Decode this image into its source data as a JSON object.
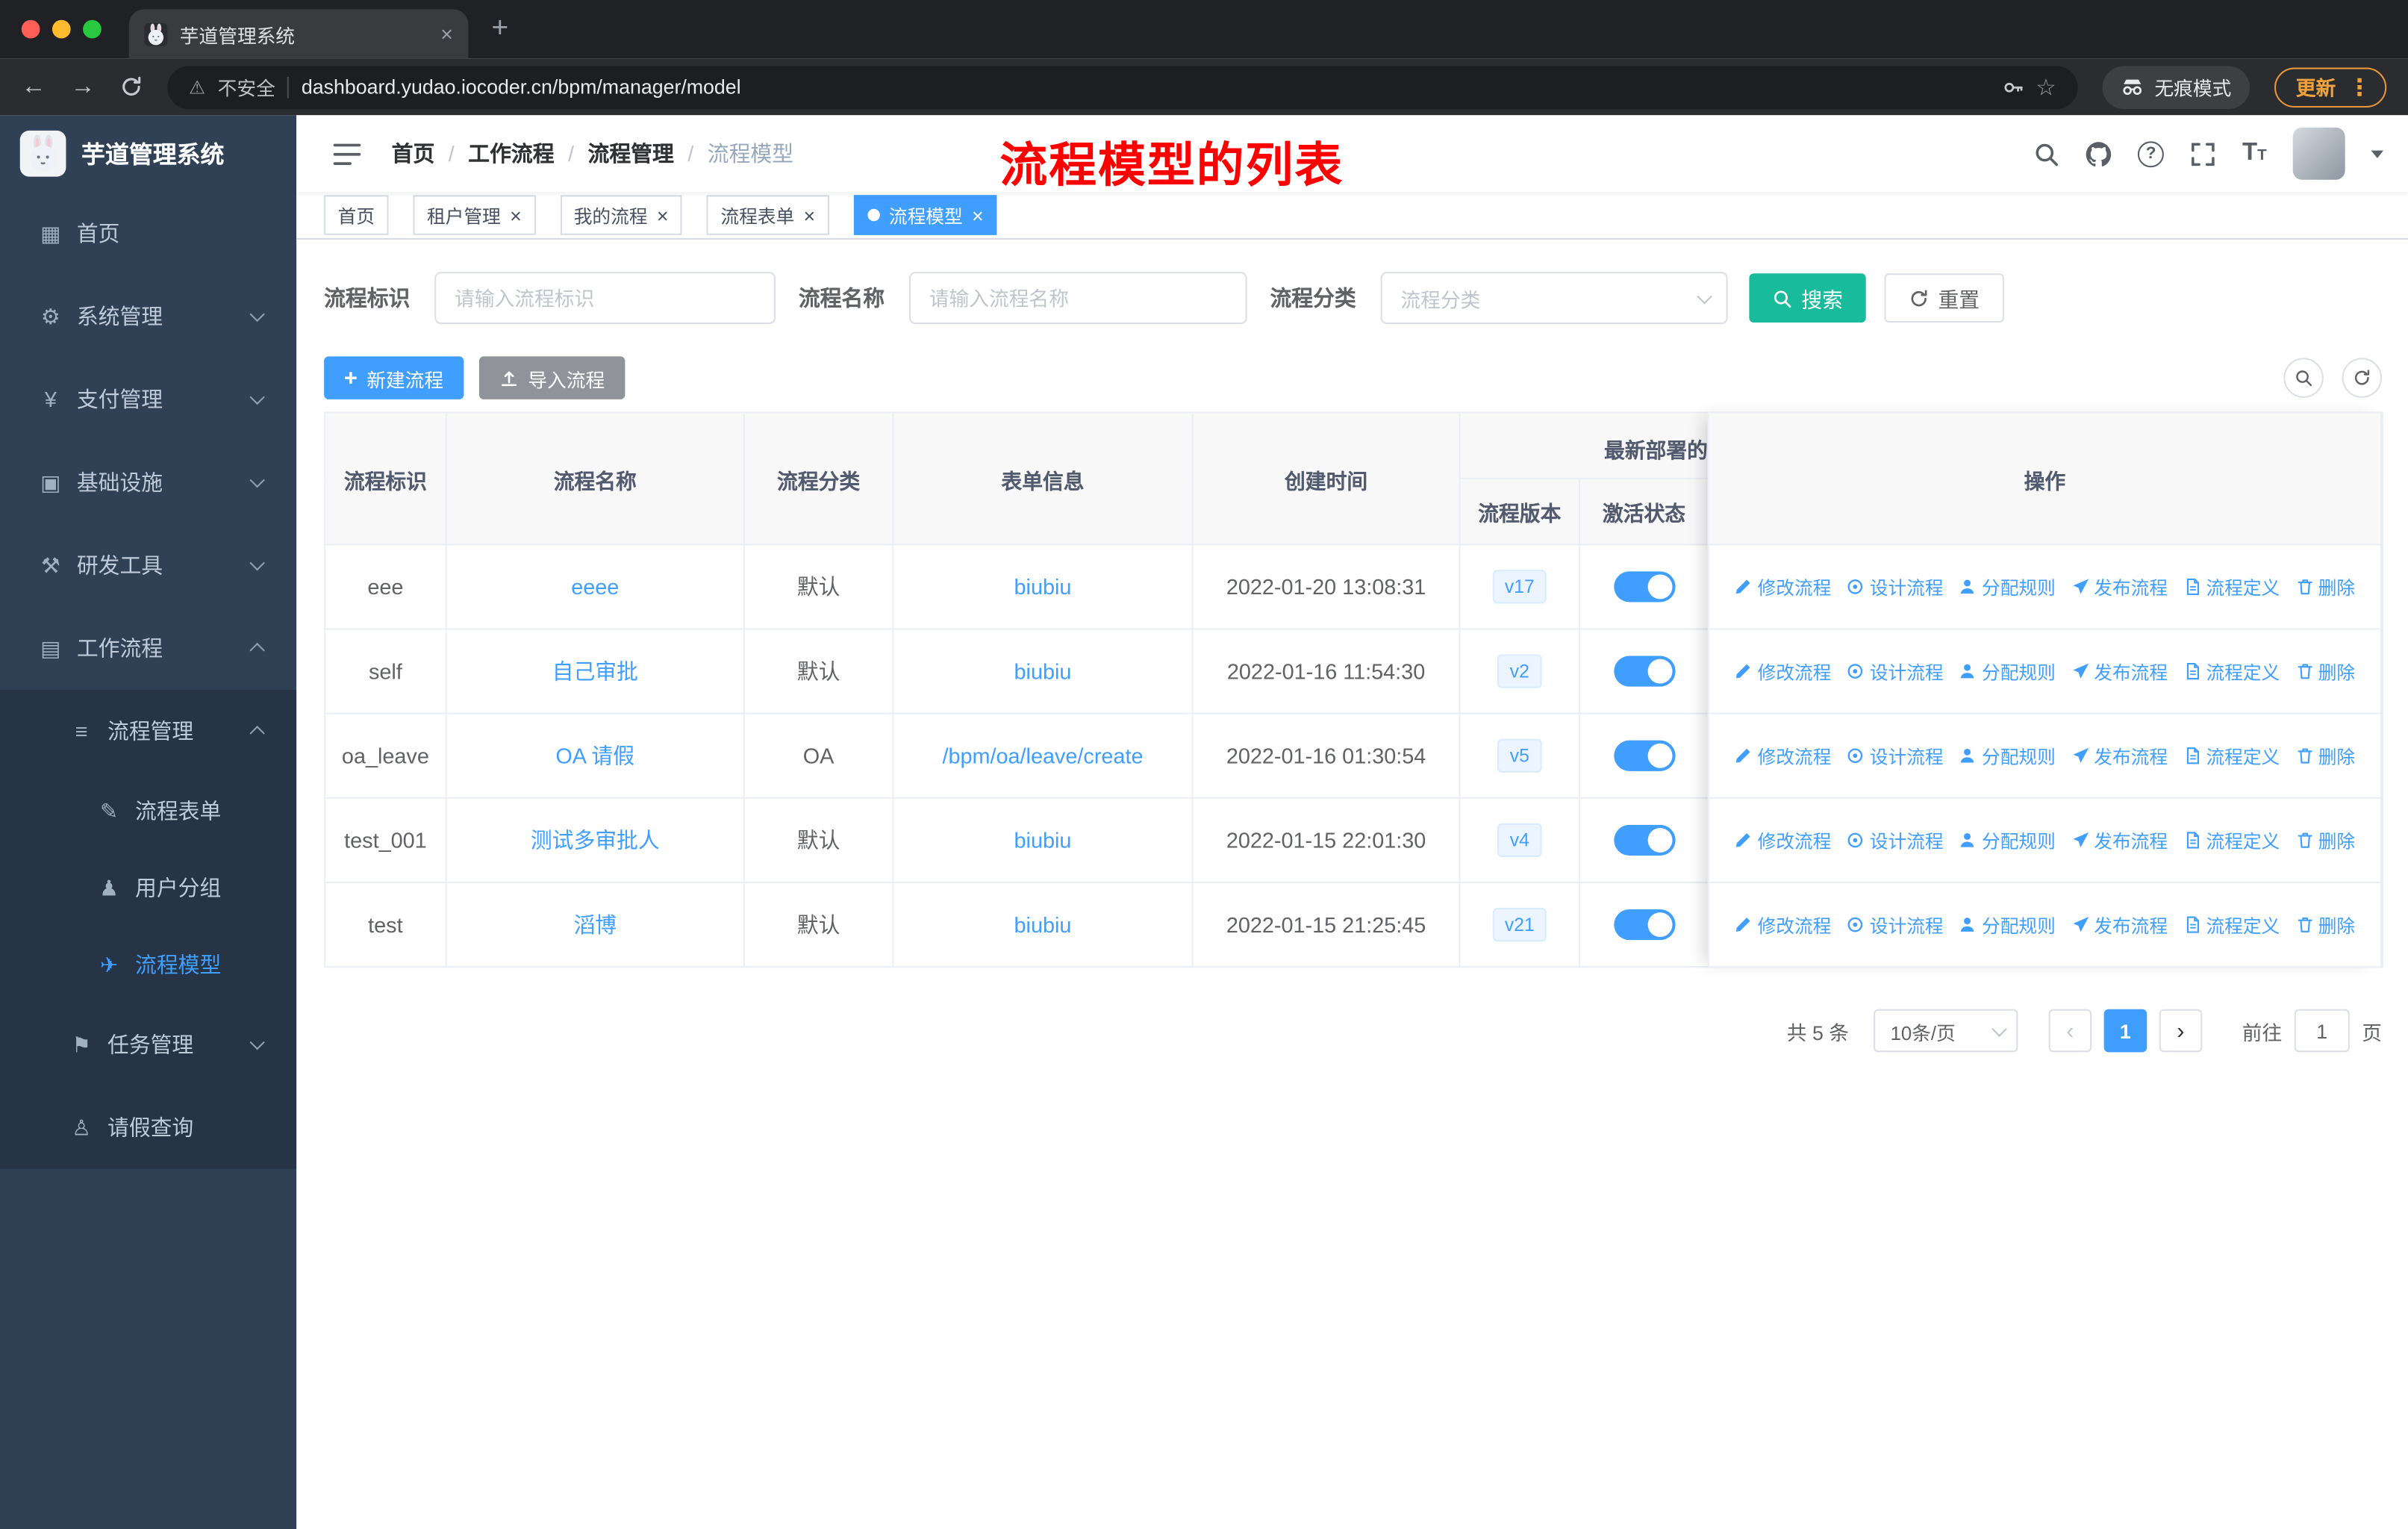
{
  "browser": {
    "tab_title": "芋道管理系统",
    "security_label": "不安全",
    "url": "dashboard.yudao.iocoder.cn/bpm/manager/model",
    "incognito_label": "无痕模式",
    "update_label": "更新"
  },
  "sidebar": {
    "logo_title": "芋道管理系统",
    "menu": [
      {
        "label": "首页",
        "icon": "home-icon"
      },
      {
        "label": "系统管理",
        "icon": "system-icon"
      },
      {
        "label": "支付管理",
        "icon": "payment-icon"
      },
      {
        "label": "基础设施",
        "icon": "infrastructure-icon"
      },
      {
        "label": "研发工具",
        "icon": "devtools-icon"
      },
      {
        "label": "工作流程",
        "icon": "workflow-icon"
      },
      {
        "label": "流程管理",
        "icon": "process-management-icon"
      },
      {
        "label": "流程表单",
        "icon": "form-icon"
      },
      {
        "label": "用户分组",
        "icon": "user-group-icon"
      },
      {
        "label": "流程模型",
        "icon": "model-icon",
        "active": true
      },
      {
        "label": "任务管理",
        "icon": "task-icon"
      },
      {
        "label": "请假查询",
        "icon": "leave-icon"
      }
    ]
  },
  "header": {
    "breadcrumb": [
      "首页",
      "工作流程",
      "流程管理",
      "流程模型"
    ],
    "annotation": "流程模型的列表",
    "icons": [
      "search-icon",
      "github-icon",
      "help-icon",
      "fullscreen-icon",
      "font-size-icon",
      "user-avatar"
    ]
  },
  "tags": [
    {
      "label": "首页",
      "closable": false,
      "active": false
    },
    {
      "label": "租户管理",
      "closable": true,
      "active": false
    },
    {
      "label": "我的流程",
      "closable": true,
      "active": false
    },
    {
      "label": "流程表单",
      "closable": true,
      "active": false
    },
    {
      "label": "流程模型",
      "closable": true,
      "active": true
    }
  ],
  "filters": {
    "fields": [
      {
        "label": "流程标识",
        "placeholder": "请输入流程标识",
        "type": "input"
      },
      {
        "label": "流程名称",
        "placeholder": "请输入流程名称",
        "type": "input"
      },
      {
        "label": "流程分类",
        "placeholder": "流程分类",
        "type": "select"
      }
    ],
    "search_button": "搜索",
    "reset_button": "重置"
  },
  "toolbar": {
    "create_button": "新建流程",
    "import_button": "导入流程",
    "icons": [
      "search-icon",
      "refresh-icon"
    ]
  },
  "table": {
    "columns": [
      "流程标识",
      "流程名称",
      "流程分类",
      "表单信息",
      "创建时间",
      "操作"
    ],
    "group_header": {
      "label": "最新部署的",
      "children": [
        "流程版本",
        "激活状态"
      ]
    },
    "rows": [
      {
        "key": "eee",
        "name": "eeee",
        "category": "默认",
        "form": "biubiu",
        "created": "2022-01-20 13:08:31",
        "version": "v17",
        "active": true
      },
      {
        "key": "self",
        "name": "自己审批",
        "category": "默认",
        "form": "biubiu",
        "created": "2022-01-16 11:54:30",
        "version": "v2",
        "active": true
      },
      {
        "key": "oa_leave",
        "name": "OA 请假",
        "category": "OA",
        "form": "/bpm/oa/leave/create",
        "created": "2022-01-16 01:30:54",
        "version": "v5",
        "active": true
      },
      {
        "key": "test_001",
        "name": "测试多审批人",
        "category": "默认",
        "form": "biubiu",
        "created": "2022-01-15 22:01:30",
        "version": "v4",
        "active": true
      },
      {
        "key": "test",
        "name": "滔博",
        "category": "默认",
        "form": "biubiu",
        "created": "2022-01-15 21:25:45",
        "version": "v21",
        "active": true
      }
    ],
    "row_actions": [
      {
        "label": "修改流程",
        "icon": "edit-icon"
      },
      {
        "label": "设计流程",
        "icon": "design-icon"
      },
      {
        "label": "分配规则",
        "icon": "assign-icon"
      },
      {
        "label": "发布流程",
        "icon": "publish-icon"
      },
      {
        "label": "流程定义",
        "icon": "definition-icon"
      },
      {
        "label": "删除",
        "icon": "delete-icon"
      }
    ]
  },
  "pagination": {
    "total_text": "共 5 条",
    "page_size": "10条/页",
    "current_page": "1",
    "goto_label": "前往",
    "goto_value": "1",
    "page_unit": "页"
  },
  "colors": {
    "primary": "#409eff",
    "search_button": "#18bc9c",
    "sidebar_bg": "#304156",
    "annotation": "#fe0000",
    "active_toggle": "#409eff"
  }
}
